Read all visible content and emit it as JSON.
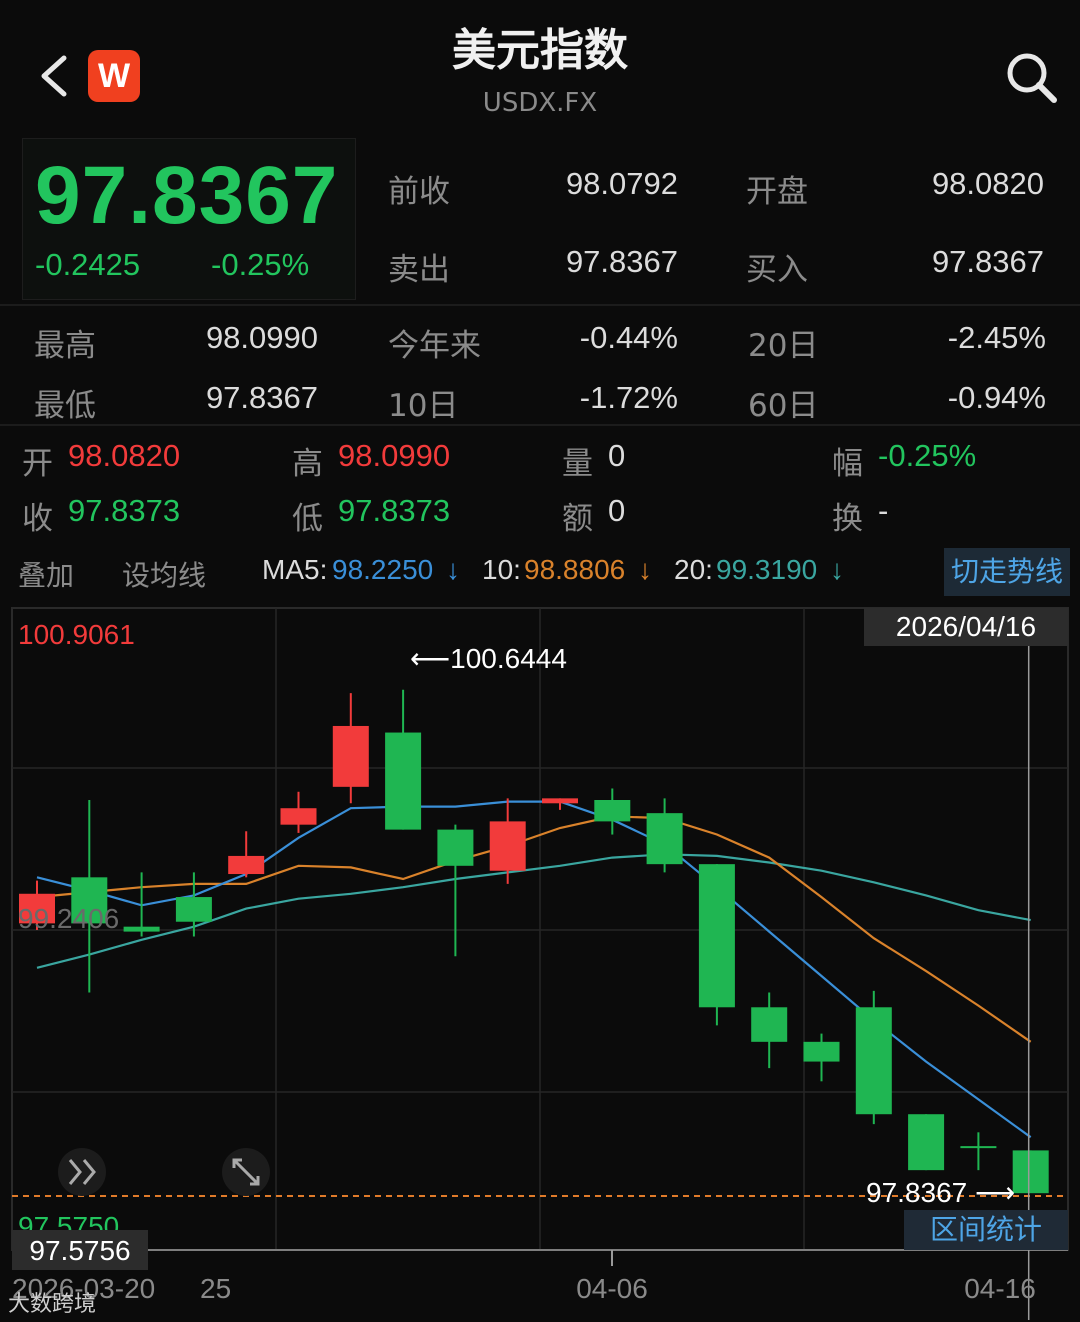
{
  "header": {
    "title": "美元指数",
    "symbol": "USDX.FX",
    "logo_letter": "W"
  },
  "quote": {
    "price": "97.8367",
    "change": "-0.2425",
    "change_pct": "-0.25%",
    "prev_close_label": "前收",
    "prev_close": "98.0792",
    "open_label": "开盘",
    "open": "98.0820",
    "ask_label": "卖出",
    "ask": "97.8367",
    "bid_label": "买入",
    "bid": "97.8367",
    "high_label": "最高",
    "high": "98.0990",
    "ytd_label": "今年来",
    "ytd": "-0.44%",
    "d20_label": "20日",
    "d20": "-2.45%",
    "low_label": "最低",
    "low": "97.8367",
    "d10_label": "10日",
    "d10": "-1.72%",
    "d60_label": "60日",
    "d60": "-0.94%"
  },
  "ohlc": {
    "open_label": "开",
    "open": "98.0820",
    "high_label": "高",
    "high": "98.0990",
    "volume_label": "量",
    "volume": "0",
    "amp_label": "幅",
    "amp": "-0.25%",
    "close_label": "收",
    "close": "97.8373",
    "low_label": "低",
    "low": "97.8373",
    "amount_label": "额",
    "amount": "0",
    "turnover_label": "换",
    "turnover": "-"
  },
  "ma_bar": {
    "overlay_label": "叠加",
    "set_ma_label": "设均线",
    "ma5_label": "MA5:",
    "ma5_value": "98.2250",
    "ma10_label": "10:",
    "ma10_value": "98.8806",
    "ma20_label": "20:",
    "ma20_value": "99.3190",
    "arrow": "↓",
    "switch_label": "切走势线"
  },
  "range_button_label": "区间统计",
  "watermark": "大数跨境",
  "colors": {
    "up": "#f23b3b",
    "down": "#1fb652",
    "ma5": "#3a8fd8",
    "ma10": "#d9822b",
    "ma20": "#3aa6a0",
    "accent": "#4ea5e6"
  },
  "chart_data": {
    "type": "candlestick",
    "y_max_label": "100.9061",
    "y_mid_label": "99.2406",
    "y_min_label": "97.5750",
    "crosshair_price": "97.5756",
    "crosshair_date": "2026/04/16",
    "max_annotation": "100.6444",
    "last_annotation": "97.8367",
    "ylim": [
      97.575,
      100.9061
    ],
    "x_tick_labels": [
      "2026-03-20",
      "25",
      "04-06",
      "04-16"
    ],
    "candles": [
      {
        "o": 99.22,
        "h": 99.48,
        "l": 99.18,
        "c": 99.4
      },
      {
        "o": 99.5,
        "h": 99.97,
        "l": 98.8,
        "c": 99.22
      },
      {
        "o": 99.2,
        "h": 99.53,
        "l": 99.14,
        "c": 99.17
      },
      {
        "o": 99.38,
        "h": 99.53,
        "l": 99.14,
        "c": 99.23
      },
      {
        "o": 99.52,
        "h": 99.78,
        "l": 99.5,
        "c": 99.63
      },
      {
        "o": 99.82,
        "h": 100.02,
        "l": 99.77,
        "c": 99.92
      },
      {
        "o": 100.05,
        "h": 100.62,
        "l": 99.95,
        "c": 100.42
      },
      {
        "o": 100.38,
        "h": 100.64,
        "l": 99.79,
        "c": 99.79
      },
      {
        "o": 99.79,
        "h": 99.82,
        "l": 99.02,
        "c": 99.57
      },
      {
        "o": 99.54,
        "h": 99.98,
        "l": 99.46,
        "c": 99.84
      },
      {
        "o": 99.95,
        "h": 99.98,
        "l": 99.91,
        "c": 99.98
      },
      {
        "o": 99.97,
        "h": 100.04,
        "l": 99.76,
        "c": 99.84
      },
      {
        "o": 99.89,
        "h": 99.98,
        "l": 99.53,
        "c": 99.58
      },
      {
        "o": 99.58,
        "h": 99.58,
        "l": 98.6,
        "c": 98.71
      },
      {
        "o": 98.71,
        "h": 98.8,
        "l": 98.34,
        "c": 98.5
      },
      {
        "o": 98.5,
        "h": 98.55,
        "l": 98.26,
        "c": 98.38
      },
      {
        "o": 98.71,
        "h": 98.81,
        "l": 98.0,
        "c": 98.06
      },
      {
        "o": 98.06,
        "h": 98.06,
        "l": 97.72,
        "c": 97.72
      },
      {
        "o": 97.86,
        "h": 97.95,
        "l": 97.72,
        "c": 97.86
      },
      {
        "o": 97.84,
        "h": 97.84,
        "l": 97.6,
        "c": 97.58
      }
    ],
    "ma5": [
      99.5,
      99.42,
      99.33,
      99.39,
      99.52,
      99.74,
      99.92,
      99.93,
      99.93,
      99.96,
      99.96,
      99.85,
      99.7,
      99.44,
      99.17,
      98.9,
      98.63,
      98.38,
      98.15,
      97.92
    ],
    "ma10": [
      99.38,
      99.41,
      99.44,
      99.46,
      99.46,
      99.57,
      99.56,
      99.49,
      99.6,
      99.69,
      99.8,
      99.87,
      99.86,
      99.76,
      99.62,
      99.38,
      99.13,
      98.93,
      98.72,
      98.5
    ],
    "ma20": [
      98.95,
      99.03,
      99.12,
      99.2,
      99.31,
      99.37,
      99.4,
      99.44,
      99.49,
      99.53,
      99.57,
      99.62,
      99.64,
      99.63,
      99.59,
      99.54,
      99.47,
      99.39,
      99.3,
      99.24
    ]
  }
}
